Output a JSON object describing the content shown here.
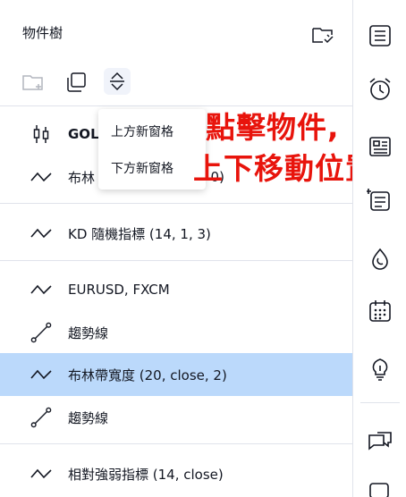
{
  "panel": {
    "title": "物件樹"
  },
  "rows": [
    {
      "label": "GOL",
      "icon": "candlestick-icon"
    },
    {
      "label": "布林",
      "suffix": ", 0)",
      "icon": "wave-icon"
    },
    {
      "label": "KD 隨機指標 (14, 1, 3)",
      "icon": "wave-icon"
    },
    {
      "label": "EURUSD, FXCM",
      "icon": "wave-icon"
    },
    {
      "label": "趨勢線",
      "icon": "trendline-icon"
    },
    {
      "label": "布林帶寬度 (20, close, 2)",
      "icon": "wave-icon"
    },
    {
      "label": "趨勢線",
      "icon": "trendline-icon"
    },
    {
      "label": "相對強弱指標 (14, close)",
      "icon": "wave-icon"
    }
  ],
  "popup": {
    "item1": "上方新窗格",
    "item2": "下方新窗格"
  },
  "annotation": {
    "line1": "點擊物件,",
    "line2": "上下移動位置",
    "color": "#e8140c"
  },
  "colors": {
    "selected_row": "#bbd9fb",
    "separator": "#e0e3eb"
  }
}
